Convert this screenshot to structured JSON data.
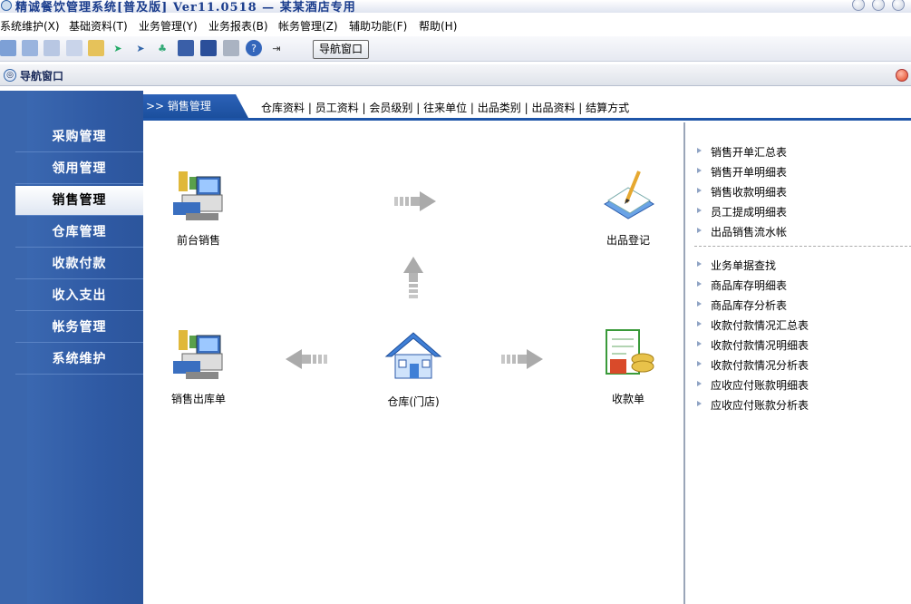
{
  "titlebar": {
    "title": "精诚餐饮管理系统[普及版] Ver11.0518 — 某某酒店专用"
  },
  "menu": [
    "系统维护(X)",
    "基础资料(T)",
    "业务管理(Y)",
    "业务报表(B)",
    "帐务管理(Z)",
    "辅助功能(F)",
    "帮助(H)"
  ],
  "toolbar": {
    "nav_button": "导航窗口"
  },
  "subwindow": {
    "title": "导航窗口"
  },
  "sidebar": {
    "items": [
      "采购管理",
      "领用管理",
      "销售管理",
      "仓库管理",
      "收款付款",
      "收入支出",
      "帐务管理",
      "系统维护"
    ],
    "active": "销售管理"
  },
  "tabs": {
    "active": ">> 销售管理",
    "links": [
      "仓库资料",
      "员工资料",
      "会员级别",
      "往来单位",
      "出品类别",
      "出品资料",
      "结算方式"
    ]
  },
  "flow": {
    "front_sales": "前台销售",
    "output_register": "出品登记",
    "sales_out": "销售出库单",
    "warehouse": "仓库(门店)",
    "receipt": "收款单"
  },
  "reports_group1": [
    "销售开单汇总表",
    "销售开单明细表",
    "销售收款明细表",
    "员工提成明细表",
    "出品销售流水帐"
  ],
  "reports_group2": [
    "业务单据查找",
    "商品库存明细表",
    "商品库存分析表",
    "收款付款情况汇总表",
    "收款付款情况明细表",
    "收款付款情况分析表",
    "应收应付账款明细表",
    "应收应付账款分析表"
  ],
  "colors": {
    "sidebar": "#2f5aa4",
    "accent": "#1e55a8"
  }
}
